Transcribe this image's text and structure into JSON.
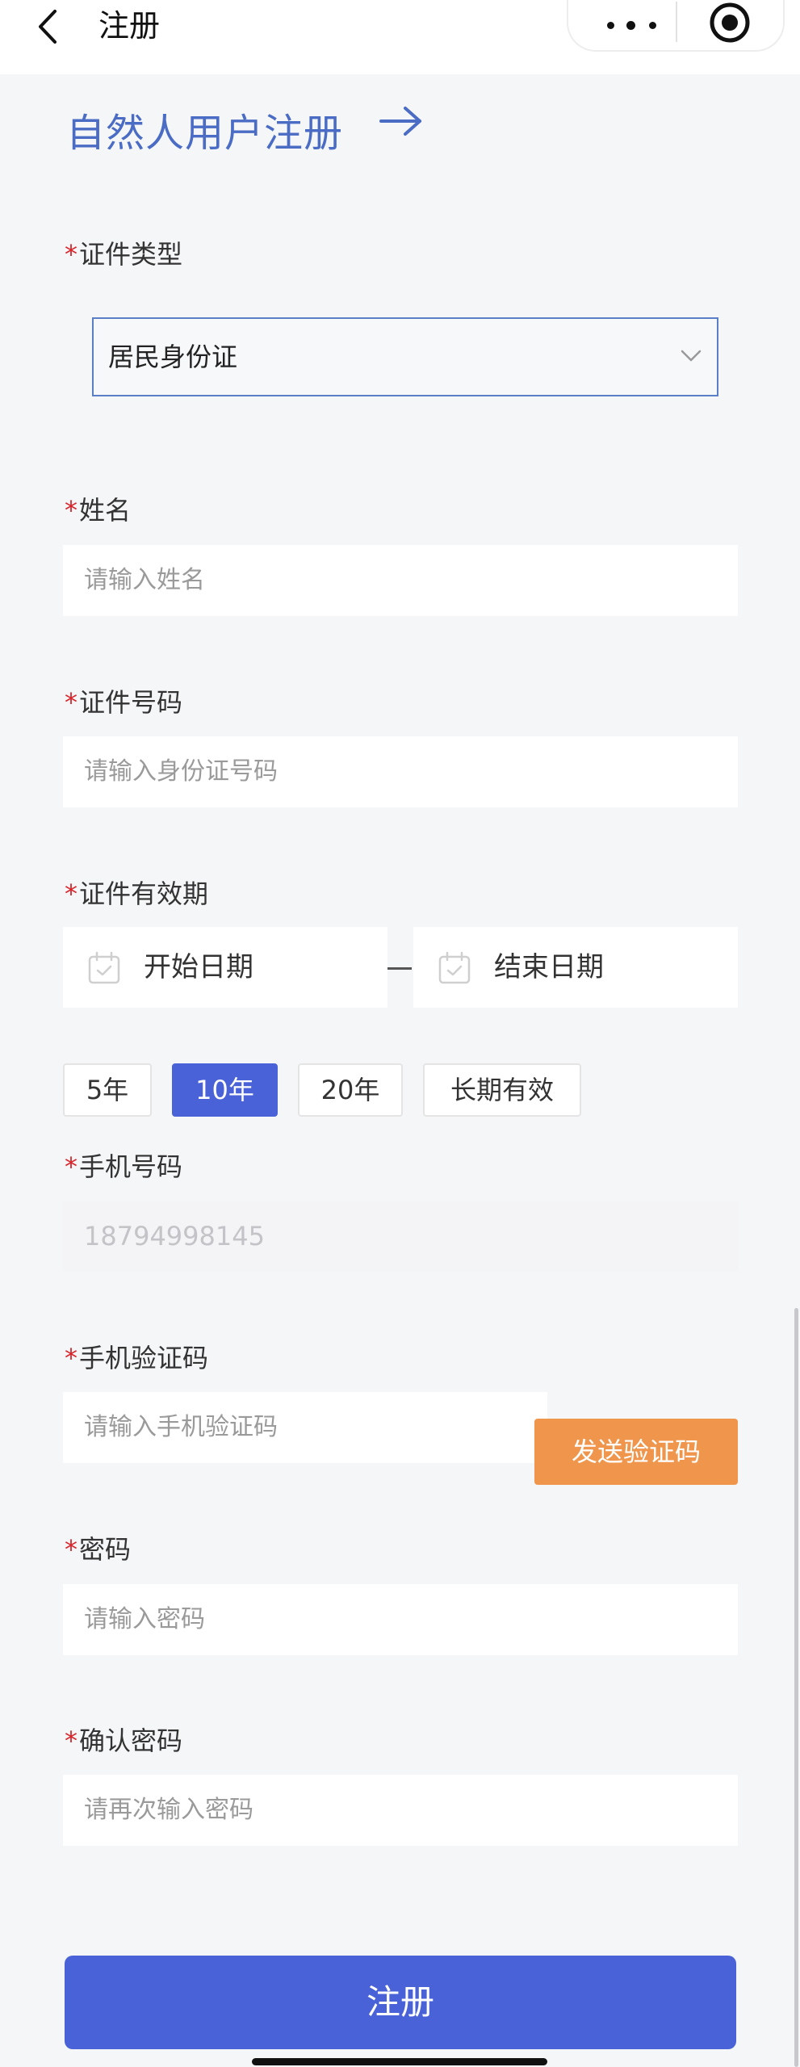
{
  "nav": {
    "title": "注册"
  },
  "header": {
    "title": "自然人用户注册"
  },
  "form": {
    "id_type": {
      "required": "*",
      "label": "证件类型",
      "value": "居民身份证"
    },
    "name": {
      "required": "*",
      "label": "姓名",
      "placeholder": "请输入姓名"
    },
    "id_number": {
      "required": "*",
      "label": "证件号码",
      "placeholder": "请输入身份证号码"
    },
    "validity": {
      "required": "*",
      "label": "证件有效期",
      "start_placeholder": "开始日期",
      "end_placeholder": "结束日期",
      "durations": [
        "5年",
        "10年",
        "20年",
        "长期有效"
      ],
      "selected": "10年"
    },
    "phone": {
      "required": "*",
      "label": "手机号码",
      "value": "18794998145"
    },
    "sms_code": {
      "required": "*",
      "label": "手机验证码",
      "placeholder": "请输入手机验证码",
      "send_label": "发送验证码"
    },
    "password": {
      "required": "*",
      "label": "密码",
      "placeholder": "请输入密码"
    },
    "confirm_password": {
      "required": "*",
      "label": "确认密码",
      "placeholder": "请再次输入密码"
    }
  },
  "submit_label": "注册",
  "colors": {
    "primary": "#4a62d8",
    "title_blue": "#4a6cc4",
    "required_red": "#d9252b",
    "send_button_orange": "#f0964c",
    "page_background": "#f5f6f8"
  },
  "icons": [
    "back-arrow-icon",
    "more-dots-icon",
    "target-icon",
    "right-arrow-icon",
    "chevron-down-icon",
    "calendar-icon"
  ]
}
